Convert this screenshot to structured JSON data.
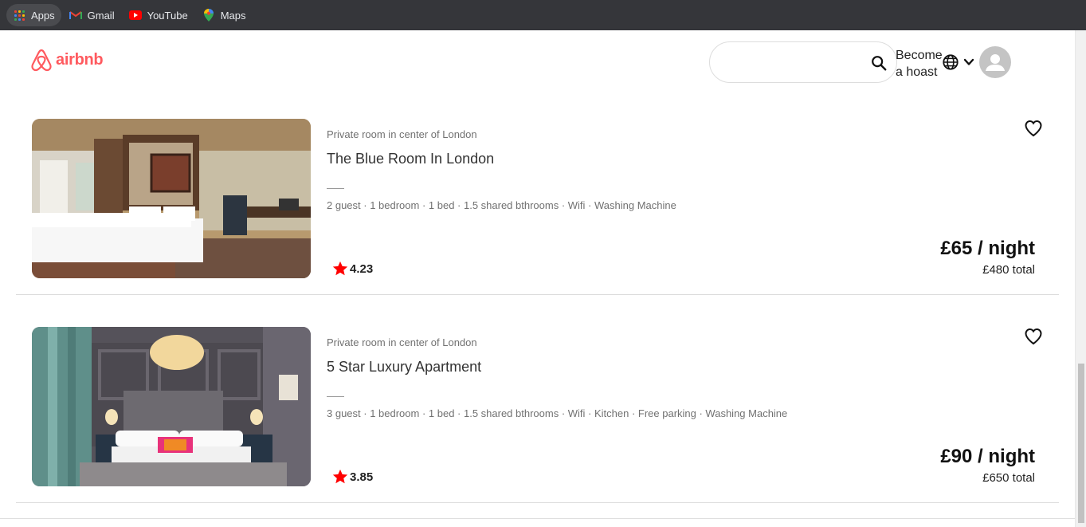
{
  "bookmarks": [
    {
      "label": "Apps",
      "icon": "apps-grid-icon"
    },
    {
      "label": "Gmail",
      "icon": "gmail-icon"
    },
    {
      "label": "YouTube",
      "icon": "youtube-icon"
    },
    {
      "label": "Maps",
      "icon": "maps-icon"
    }
  ],
  "header": {
    "logo_text": "airbnb",
    "search_value": "",
    "search_placeholder": "",
    "become_host_line1": "Become",
    "become_host_line2": "a hoast"
  },
  "listings": [
    {
      "subtitle": "Private room in center of London",
      "title": "The Blue Room In London",
      "amenities": "2 guest · 1 bedroom · 1 bed · 1.5 shared bthrooms · Wifi · Washing Machine",
      "rating": "4.23",
      "price": "£65 / night",
      "total": "£480 total"
    },
    {
      "subtitle": "Private room in center of London",
      "title": "5 Star Luxury Apartment",
      "amenities": "3 guest · 1 bedroom · 1 bed · 1.5 shared bthrooms · Wifi · Kitchen · Free parking · Washing Machine",
      "rating": "3.85",
      "price": "£90 / night",
      "total": "£650 total"
    }
  ],
  "colors": {
    "brand": "#ff5a5f",
    "star": "#ff0000",
    "bookmarks_bar": "#35363a"
  }
}
